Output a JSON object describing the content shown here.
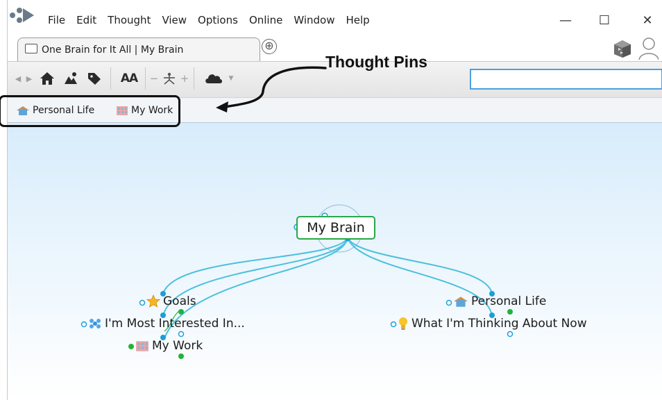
{
  "menubar": {
    "items": [
      "File",
      "Edit",
      "Thought",
      "View",
      "Options",
      "Online",
      "Window",
      "Help"
    ]
  },
  "window_controls": {
    "minimize": "—",
    "maximize": "☐",
    "close": "✕"
  },
  "tab": {
    "label": "One Brain for It All | My Brain",
    "new_tab_symbol": "⊕"
  },
  "toolbar": {
    "font_label": "AA",
    "minus_label": "−",
    "plus_label": "+",
    "search_value": ""
  },
  "pins": [
    {
      "label": "Personal Life",
      "icon": "house-icon"
    },
    {
      "label": "My Work",
      "icon": "office-building-icon"
    }
  ],
  "annotation": {
    "text": "Thought Pins"
  },
  "plex": {
    "central": {
      "label": "My Brain"
    },
    "children": [
      {
        "label": "Goals",
        "icon": "star-icon"
      },
      {
        "label": "I'm Most Interested In...",
        "icon": "atom-icon"
      },
      {
        "label": "My Work",
        "icon": "office-building-icon"
      },
      {
        "label": "Personal Life",
        "icon": "house-icon"
      },
      {
        "label": "What I'm Thinking About Now",
        "icon": "lightbulb-icon"
      }
    ]
  },
  "colors": {
    "link_blue": "#4ac0dc",
    "node_dot_blue": "#1a9fd8",
    "node_dot_green": "#22b33a",
    "central_border": "#27a84a",
    "search_border": "#4a9fe0"
  }
}
